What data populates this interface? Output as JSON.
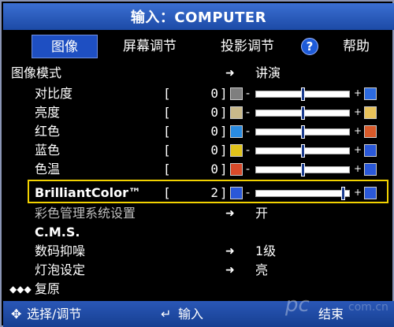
{
  "title": "输入：COMPUTER",
  "tabs": [
    {
      "label": "图像",
      "active": true
    },
    {
      "label": "屏幕调节",
      "active": false
    },
    {
      "label": "投影调节",
      "active": false
    },
    {
      "label": "帮助",
      "active": false
    }
  ],
  "help_icon_glyph": "?",
  "image_mode": {
    "label": "图像模式",
    "value": "讲演"
  },
  "sliders": [
    {
      "label": "对比度",
      "value": "0",
      "fraction": 0.5,
      "left_icon": "contrast-icon",
      "right_icon": "contrast-high-icon",
      "left_color": "#7f7f7f",
      "right_color": "#2d6be0"
    },
    {
      "label": "亮度",
      "value": "0",
      "fraction": 0.5,
      "left_icon": "brightness-low-icon",
      "right_icon": "brightness-high-icon",
      "left_color": "#c9b98a",
      "right_color": "#e8c25a"
    },
    {
      "label": "红色",
      "value": "0",
      "fraction": 0.5,
      "left_icon": "red-low-icon",
      "right_icon": "red-high-icon",
      "left_color": "#2a8be0",
      "right_color": "#d85a2a"
    },
    {
      "label": "蓝色",
      "value": "0",
      "fraction": 0.5,
      "left_icon": "blue-low-icon",
      "right_icon": "blue-high-icon",
      "left_color": "#e0c21a",
      "right_color": "#2a58d8"
    },
    {
      "label": "色温",
      "value": "0",
      "fraction": 0.5,
      "left_icon": "warm-temp-icon",
      "right_icon": "cool-temp-icon",
      "left_color": "#d84a2a",
      "right_color": "#2a58d8"
    },
    {
      "label": "BrilliantColor™",
      "value": "2",
      "fraction": 0.95,
      "left_icon": "brilliantcolor-low-icon",
      "right_icon": "brilliantcolor-high-icon",
      "left_color": "#2a58d8",
      "right_color": "#2a58d8"
    }
  ],
  "color_mgmt": {
    "label": "彩色管理系统设置",
    "value": "开"
  },
  "cms": {
    "label": "C.M.S."
  },
  "noise": {
    "label": "数码抑噪",
    "value": "1级"
  },
  "lamp": {
    "label": "灯泡设定",
    "value": "亮"
  },
  "reset": {
    "label": "复原"
  },
  "footer": {
    "select": "选择/调节",
    "enter": "输入",
    "exit": "结束"
  },
  "watermark": "pc",
  "watermark2": "com.cn"
}
